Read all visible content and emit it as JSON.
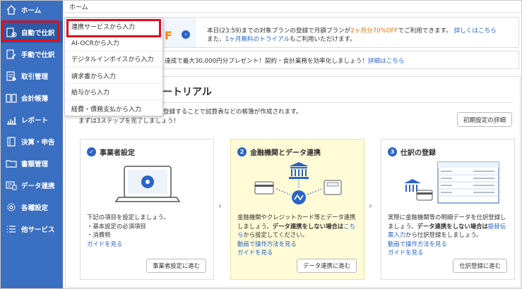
{
  "sidebar": {
    "items": [
      {
        "label": "ホーム",
        "icon": "home-icon"
      },
      {
        "label": "自動で仕訳",
        "icon": "auto-entry-icon"
      },
      {
        "label": "手動で仕訳",
        "icon": "manual-entry-icon"
      },
      {
        "label": "取引管理",
        "icon": "transactions-icon"
      },
      {
        "label": "会計帳簿",
        "icon": "ledger-icon"
      },
      {
        "label": "レポート",
        "icon": "report-icon"
      },
      {
        "label": "決算・申告",
        "icon": "closing-icon"
      },
      {
        "label": "書類管理",
        "icon": "folder-icon"
      },
      {
        "label": "データ連携",
        "icon": "data-link-icon"
      },
      {
        "label": "各種設定",
        "icon": "gear-icon"
      },
      {
        "label": "他サービス",
        "icon": "list-icon"
      }
    ]
  },
  "breadcrumb": "ホーム",
  "dropdown": {
    "items": [
      "連携サービスから入力",
      "AI-OCRから入力",
      "デジタルインボイスから入力",
      "請求書から入力",
      "給与から入力",
      "経費・債務支払から入力"
    ]
  },
  "banner1": {
    "letter": "F",
    "line1_a": "本日(23:59)までの対象プランの登録で月額プランが",
    "line1_highlight": "2ヶ月分70%OFF",
    "line1_b": "でご利用できます。",
    "line1_link": "詳しくはこちら",
    "line2_a": "また、",
    "line2_link": "1ヶ月無料のトライアル",
    "line2_b": "もご利用いただけます。"
  },
  "banner2": {
    "text": "達成で最大30,000円分プレゼント！契約・会計業務を効率化しましょう！",
    "link": "詳細はこちら"
  },
  "tutorial": {
    "title": "ートリアル",
    "desc_line1": "登録することで試算表などの帳簿が作成されます。",
    "desc_line2": "まずは3ステップを完了しましょう！",
    "detail_button": "初期設定の詳細"
  },
  "cards": [
    {
      "title": "事業者設定",
      "body1": "下記の項目を設定しましょう。",
      "body2": "・基本設定の必須項目",
      "body3": "・消費税",
      "guide": "ガイドを見る",
      "button": "事業者設定に進む"
    },
    {
      "num": "2",
      "title": "金融機関とデータ連携",
      "body1": "金融機関やクレジットカード等とデータ連携しましょう。",
      "bold": "データ連携をしない場合は",
      "link": "こちら",
      "body2": "から設定してください。",
      "video": "動画で操作方法を見る",
      "guide": "ガイドを見る",
      "button": "データ連携に進む"
    },
    {
      "num": "3",
      "title": "仕訳の登録",
      "body1": "実際に金融機関等の明細データを仕訳登録しましょう。",
      "bold": "データ連携をしない場合は",
      "link": "振替伝票入力",
      "body2": "から仕訳登録をしましょう。",
      "video": "動画で操作方法を見る",
      "guide": "ガイドを見る",
      "button": "仕訳登録に進む"
    }
  ],
  "colors": {
    "sidebar": "#3b6fc1",
    "highlight_box": "#e10d1f",
    "accent_blue": "#2a64c6",
    "orange": "#e86b00"
  }
}
